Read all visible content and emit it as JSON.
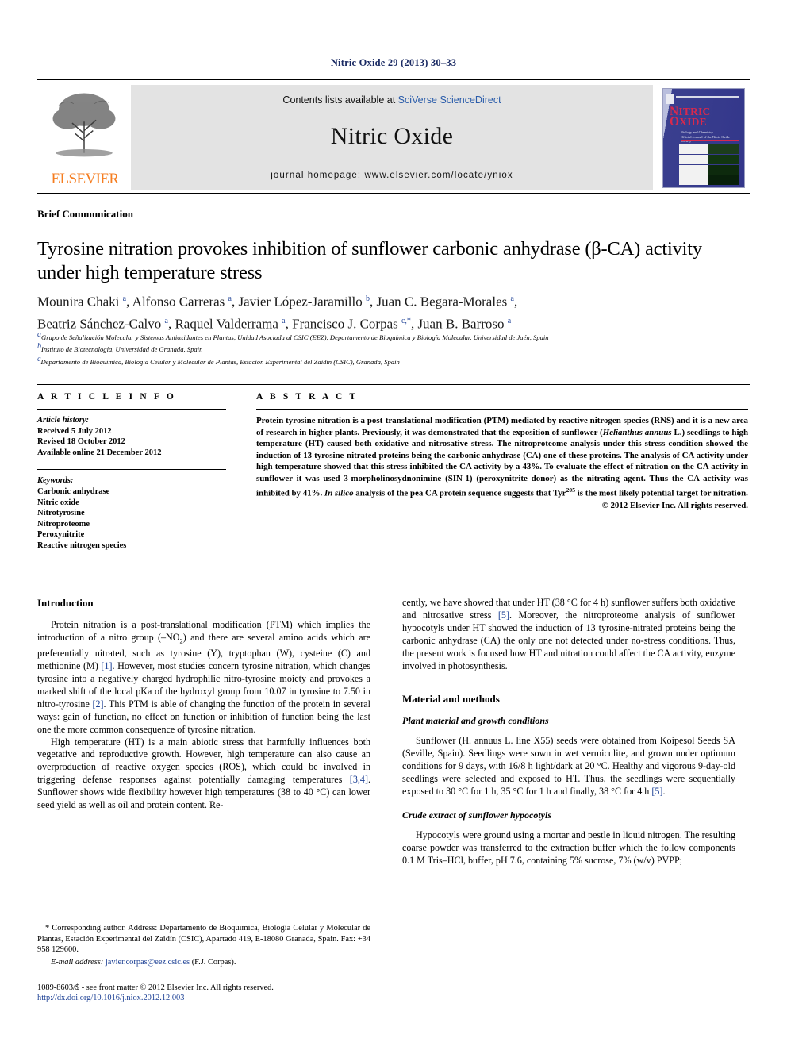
{
  "running_head": "Nitric Oxide 29 (2013) 30–33",
  "masthead": {
    "contents_prefix": "Contents lists available at ",
    "contents_link": "SciVerse ScienceDirect",
    "journal_name": "Nitric Oxide",
    "homepage": "journal homepage: www.elsevier.com/locate/yniox",
    "publisher_logo_text": "ELSEVIER",
    "cover": {
      "title_line1": "NITRIC",
      "title_line2": "OXIDE",
      "subtitle": "Biology and Chemistry",
      "subtitle2": "Official Journal of the Nitric Oxide Society"
    }
  },
  "article": {
    "type": "Brief Communication",
    "title": "Tyrosine nitration provokes inhibition of sunflower carbonic anhydrase (β-CA) activity under high temperature stress",
    "authors_line1": "Mounira Chaki a, Alfonso Carreras a, Javier López-Jaramillo b, Juan C. Begara-Morales a,",
    "authors_line2": "Beatriz Sánchez-Calvo a, Raquel Valderrama a, Francisco J. Corpas c,*, Juan B. Barroso a",
    "affiliations": [
      {
        "mark": "a",
        "text": "Grupo de Señalización Molecular y Sistemas Antioxidantes en Plantas, Unidad Asociada al CSIC (EEZ), Departamento de Bioquímica y Biología Molecular, Universidad de Jaén, Spain"
      },
      {
        "mark": "b",
        "text": "Instituto de Biotecnología, Universidad de Granada, Spain"
      },
      {
        "mark": "c",
        "text": "Departamento de Bioquímica, Biología Celular y Molecular de Plantas, Estación Experimental del Zaidín (CSIC), Granada, Spain"
      }
    ]
  },
  "article_info": {
    "heading": "A R T I C L E   I N F O",
    "history_label": "Article history:",
    "history": [
      "Received 5 July 2012",
      "Revised 18 October 2012",
      "Available online 21 December 2012"
    ],
    "keywords_label": "Keywords:",
    "keywords": [
      "Carbonic anhydrase",
      "Nitric oxide",
      "Nitrotyrosine",
      "Nitroproteome",
      "Peroxynitrite",
      "Reactive nitrogen species"
    ]
  },
  "abstract": {
    "heading": "A B S T R A C T",
    "part1": "Protein tyrosine nitration is a post-translational modification (PTM) mediated by reactive nitrogen species (RNS) and it is a new area of research in higher plants. Previously, it was demonstrated that the exposition of sunflower (",
    "italic1": "Helianthus annuus",
    "part2": " L.) seedlings to high temperature (HT) caused both oxidative and nitrosative stress. The nitroproteome analysis under this stress condition showed the induction of 13 tyrosine-nitrated proteins being the carbonic anhydrase (CA) one of these proteins. The analysis of CA activity under high temperature showed that this stress inhibited the CA activity by a 43%. To evaluate the effect of nitration on the CA activity in sunflower it was used 3-morpholinosydnonimine (SIN-1) (peroxynitrite donor) as the nitrating agent. Thus the CA activity was inhibited by 41%. ",
    "italic2": "In silico",
    "part3": " analysis of the pea CA protein sequence suggests that Tyr",
    "sup": "205",
    "part4": " is the most likely potential target for nitration.",
    "copyright": "© 2012 Elsevier Inc. All rights reserved."
  },
  "body": {
    "left": {
      "intro_heading": "Introduction",
      "p1_a": "Protein nitration is a post-translational modification (PTM) which implies the introduction of a nitro group (–NO",
      "p1_sub": "2",
      "p1_b": ") and there are several amino acids which are preferentially nitrated, such as tyrosine (Y), tryptophan (W), cysteine (C) and methionine (M) ",
      "p1_ref1": "[1]",
      "p1_c": ". However, most studies concern tyrosine nitration, which changes tyrosine into a negatively charged hydrophilic nitro-tyrosine moiety and provokes a marked shift of the local pKa of the hydroxyl group from 10.07 in tyrosine to 7.50 in nitro-tyrosine ",
      "p1_ref2": "[2]",
      "p1_d": ". This PTM is able of changing the function of the protein in several ways: gain of function, no effect on function or inhibition of function being the last one the more common consequence of tyrosine nitration.",
      "p2_a": "High temperature (HT) is a main abiotic stress that harmfully influences both vegetative and reproductive growth. However, high temperature can also cause an overproduction of reactive oxygen species (ROS), which could be involved in triggering defense responses against potentially damaging temperatures ",
      "p2_ref": "[3,4]",
      "p2_b": ". Sunflower shows wide flexibility however high temperatures (38 to 40 °C) can lower seed yield as well as oil and protein content. Re-"
    },
    "right": {
      "p1_a": "cently, we have showed that under HT (38 °C for 4 h) sunflower suffers both oxidative and nitrosative stress ",
      "p1_ref": "[5]",
      "p1_b": ". Moreover, the nitroproteome analysis of sunflower hypocotyls under HT showed the induction of 13 tyrosine-nitrated proteins being the carbonic anhydrase (CA) the only one not detected under no-stress conditions. Thus, the present work is focused how HT and nitration could affect the CA activity, enzyme involved in photosynthesis.",
      "methods_heading": "Material and methods",
      "sub1_heading": "Plant material and growth conditions",
      "p2_a": "Sunflower (H. annuus L. line X55) seeds were obtained from Koipesol Seeds SA (Seville, Spain). Seedlings were sown in wet vermiculite, and grown under optimum conditions for 9 days, with 16/8 h light/dark at 20 °C. Healthy and vigorous 9-day-old seedlings were selected and exposed to HT. Thus, the seedlings were sequentially exposed to 30 °C for 1 h, 35 °C for 1 h and finally, 38 °C for 4 h ",
      "p2_ref": "[5]",
      "p2_b": ".",
      "sub2_heading": "Crude extract of sunflower hypocotyls",
      "p3": "Hypocotyls were ground using a mortar and pestle in liquid nitrogen. The resulting coarse powder was transferred to the extraction buffer which the follow components 0.1 M Tris–HCl, buffer, pH 7.6, containing 5% sucrose, 7% (w/v) PVPP;"
    }
  },
  "footnote": {
    "corresponding": "* Corresponding author. Address: Departamento de Bioquímica, Biología Celular y Molecular de Plantas, Estación Experimental del Zaidín (CSIC), Apartado 419, E-18080 Granada, Spain. Fax: +34 958 129600.",
    "email_label": "E-mail address:",
    "email": "javier.corpas@eez.csic.es",
    "email_suffix": " (F.J. Corpas)."
  },
  "imprint": {
    "line1": "1089-8603/$ - see front matter © 2012 Elsevier Inc. All rights reserved.",
    "doi": "http://dx.doi.org/10.1016/j.niox.2012.12.003"
  }
}
